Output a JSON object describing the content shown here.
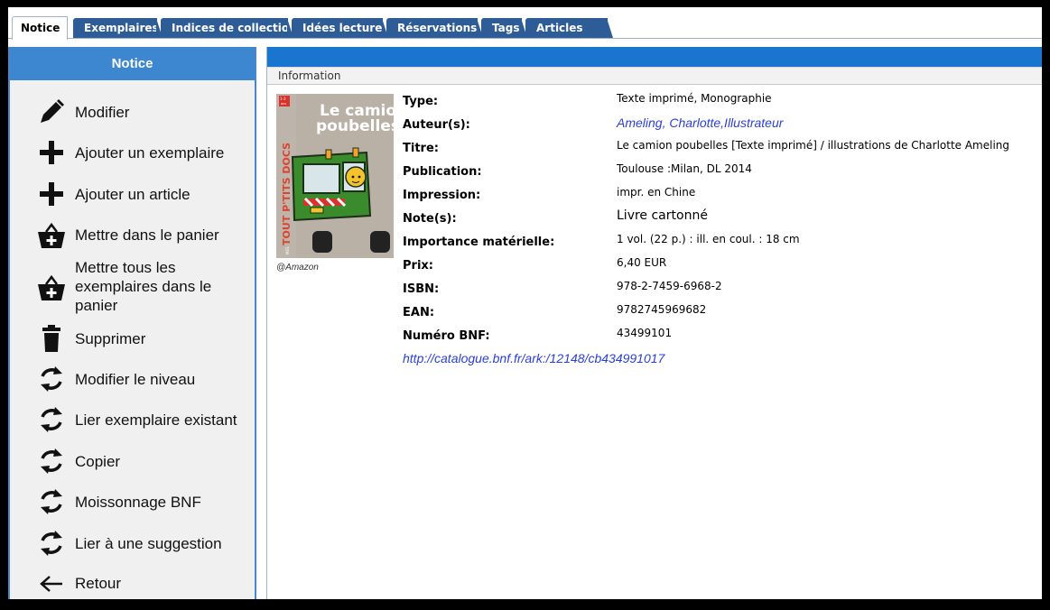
{
  "tabs": [
    {
      "label": "Notice"
    },
    {
      "label": "Exemplaires"
    },
    {
      "label": "Indices de collection"
    },
    {
      "label": "Idées lectures"
    },
    {
      "label": "Réservations"
    },
    {
      "label": "Tags"
    },
    {
      "label": "Articles"
    }
  ],
  "sidebar": {
    "title": "Notice",
    "items": [
      {
        "label": "Modifier",
        "icon": "pencil-icon"
      },
      {
        "label": "Ajouter un exemplaire",
        "icon": "plus-icon"
      },
      {
        "label": "Ajouter un article",
        "icon": "plus-icon"
      },
      {
        "label": "Mettre dans le panier",
        "icon": "basket-plus-icon"
      },
      {
        "label": "Mettre tous les exemplaires dans le panier",
        "icon": "basket-plus-icon"
      },
      {
        "label": "Supprimer",
        "icon": "trash-icon"
      },
      {
        "label": "Modifier le niveau",
        "icon": "refresh-icon"
      },
      {
        "label": "Lier exemplaire existant",
        "icon": "refresh-icon"
      },
      {
        "label": "Copier",
        "icon": "refresh-icon"
      },
      {
        "label": "Moissonnage BNF",
        "icon": "refresh-icon"
      },
      {
        "label": "Lier à une suggestion",
        "icon": "refresh-icon"
      },
      {
        "label": "Retour",
        "icon": "arrow-left-icon"
      }
    ]
  },
  "main": {
    "section_title": "Information",
    "cover": {
      "badge": "1-3 ans",
      "series": "MES TOUT P'TITS DOCS",
      "title": "Le camion poubelles",
      "credit": "@Amazon"
    },
    "fields": [
      {
        "label": "Type:",
        "value": "Texte imprimé, Monographie"
      },
      {
        "label": "Auteur(s):",
        "value": "Ameling, Charlotte,Illustrateur"
      },
      {
        "label": "Titre:",
        "value": "Le camion poubelles [Texte imprimé] / illustrations de Charlotte Ameling"
      },
      {
        "label": "Publication:",
        "value": "Toulouse :Milan, DL 2014"
      },
      {
        "label": "Impression:",
        "value": "impr. en Chine"
      },
      {
        "label": "Note(s):",
        "value": "Livre cartonné"
      },
      {
        "label": "Importance matérielle:",
        "value": "1 vol. (22 p.) : ill. en coul. : 18 cm"
      },
      {
        "label": "Prix:",
        "value": "6,40 EUR"
      },
      {
        "label": "ISBN:",
        "value": "978-2-7459-6968-2"
      },
      {
        "label": "EAN:",
        "value": "9782745969682"
      },
      {
        "label": "Numéro BNF:",
        "value": "43499101"
      }
    ],
    "bnf_link": "http://catalogue.bnf.fr/ark:/12148/cb434991017"
  },
  "colors": {
    "tab_bg": "#2d5c97",
    "sidebar_header": "#3d87d0",
    "main_header": "#1a75cf",
    "link": "#2a3fd8"
  }
}
